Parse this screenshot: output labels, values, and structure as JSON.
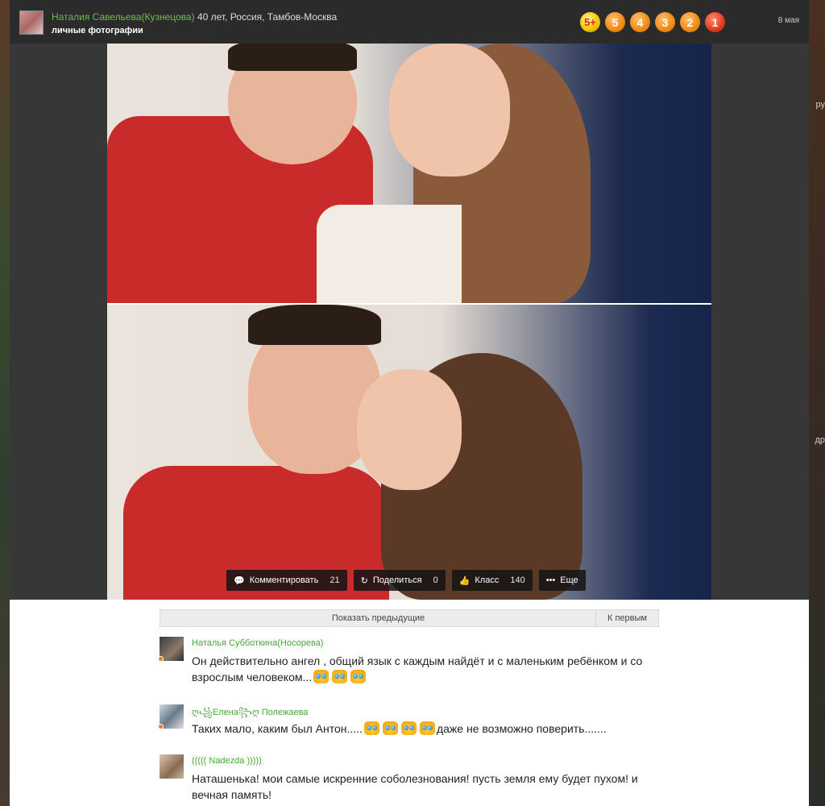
{
  "header": {
    "author_name": "Наталия Савельева(Кузнецова)",
    "author_info": " 40 лет, Россия, Тамбов-Москва",
    "album": "личные фотографии",
    "ratings": [
      "5+",
      "5",
      "4",
      "3",
      "2",
      "1"
    ],
    "date": "8 мая"
  },
  "actions": {
    "comment": {
      "label": "Комментировать",
      "count": "21"
    },
    "share": {
      "label": "Поделиться",
      "count": "0"
    },
    "like": {
      "label": "Класс",
      "count": "140"
    },
    "more": {
      "label": "Еще"
    }
  },
  "comments_nav": {
    "prev_label": "Показать предыдущие",
    "first_label": "К первым"
  },
  "comments": [
    {
      "name": "Наталья Субботкина(Носорева)",
      "text": "Он действительно ангел , общий язык с каждым найдёт и с маленьким ребёнком и со взрослым человеком...",
      "emoji_count": 3
    },
    {
      "name": "ღ꧁Елена꧂ღ Полежаева",
      "text_before": "Таких мало, каким был Антон.....",
      "text_after": "даже не возможно поверить.......",
      "emoji_count": 4
    },
    {
      "name": "((((( Nadezda )))))",
      "text": "Наташенька! мои самые искренние соболезнования! пусть земля ему будет пухом! и вечная память!"
    }
  ],
  "background_fragments": [
    "ру",
    "др"
  ],
  "colors": {
    "author_green": "#6cbf4a",
    "comment_name_green": "#4aa53a",
    "rating_orange": "#f08a10"
  }
}
